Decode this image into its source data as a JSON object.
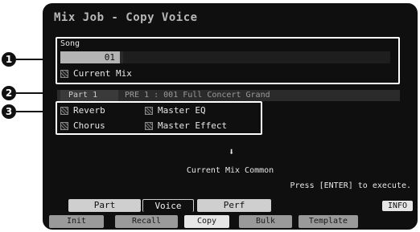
{
  "window": {
    "title": "Mix Job - Copy Voice"
  },
  "song": {
    "label": "Song",
    "value": "01"
  },
  "current_mix": {
    "label": "Current Mix"
  },
  "part_row": {
    "part": "Part 1",
    "voice": "PRE 1 : 001 Full Concert Grand"
  },
  "options": [
    {
      "label": "Reverb"
    },
    {
      "label": "Master EQ"
    },
    {
      "label": "Chorus"
    },
    {
      "label": "Master Effect"
    }
  ],
  "destination": {
    "arrow": "⬇",
    "label": "Current Mix Common"
  },
  "hint": "Press [ENTER] to execute.",
  "tabs": [
    {
      "label": "Part",
      "active": false
    },
    {
      "label": "Voice",
      "active": true
    },
    {
      "label": "Perf",
      "active": false
    }
  ],
  "info_button": "INFO",
  "subtabs": [
    {
      "label": "Init",
      "active": false
    },
    {
      "label": "Recall",
      "active": false
    },
    {
      "label": "Copy",
      "active": true
    },
    {
      "label": "Bulk",
      "active": false
    },
    {
      "label": "Template",
      "active": false
    }
  ],
  "callouts": [
    "1",
    "2",
    "3"
  ],
  "colors": {
    "screen_bg": "#0f0f0f",
    "text": "#e6e6e6",
    "highlight": "#ffffff"
  }
}
